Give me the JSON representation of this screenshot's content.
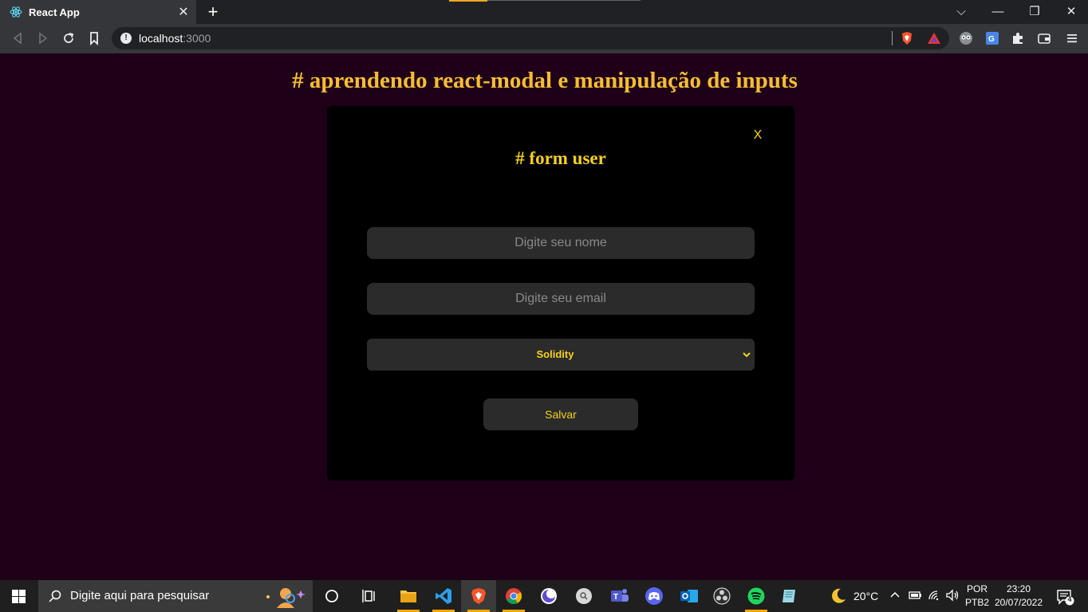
{
  "browser": {
    "tab_title": "React App",
    "tab_close": "✕",
    "new_tab": "+",
    "url_host": "localhost",
    "url_port": ":3000",
    "window_controls": {
      "dropdown": "⌵",
      "minimize": "—",
      "restore": "❐",
      "close": "✕"
    }
  },
  "page": {
    "title": "# aprendendo react-modal e manipulação de inputs"
  },
  "modal": {
    "close_label": "X",
    "title": "# form user",
    "name_placeholder": "Digite seu nome",
    "email_placeholder": "Digite seu email",
    "select_value": "Solidity",
    "save_label": "Salvar"
  },
  "taskbar": {
    "search_placeholder": "Digite aqui para pesquisar",
    "weather": "20°C",
    "language_line1": "POR",
    "language_line2": "PTB2",
    "time": "23:20",
    "date": "20/07/2022",
    "notification_count": "4"
  },
  "colors": {
    "page_bg": "#1e0018",
    "title_accent": "#f6bd31",
    "modal_accent": "#f6d11a"
  }
}
